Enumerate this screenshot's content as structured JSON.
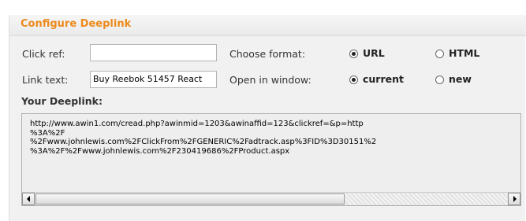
{
  "panel": {
    "title": "Configure Deeplink",
    "title_color": "#ec8a1c"
  },
  "form": {
    "click_ref": {
      "label": "Click ref:",
      "value": ""
    },
    "link_text": {
      "label": "Link text:",
      "value": "Buy Reebok 51457 React"
    },
    "format": {
      "label": "Choose format:",
      "options": [
        {
          "label": "URL",
          "selected": true
        },
        {
          "label": "HTML",
          "selected": false
        }
      ]
    },
    "window": {
      "label": "Open in window:",
      "options": [
        {
          "label": "current",
          "selected": true
        },
        {
          "label": "new",
          "selected": false
        }
      ]
    }
  },
  "deeplink": {
    "title": "Your Deeplink:",
    "value": "http://www.awin1.com/cread.php?awinmid=1203&awinaffid=123&clickref=&p=http\n%3A%2F\n%2Fwww.johnlewis.com%2FClickFrom%2FGENERIC%2Fadtrack.asp%3FID%3D30151%2\n%3A%2F%2Fwww.johnlewis.com%2F230419686%2FProduct.aspx"
  }
}
